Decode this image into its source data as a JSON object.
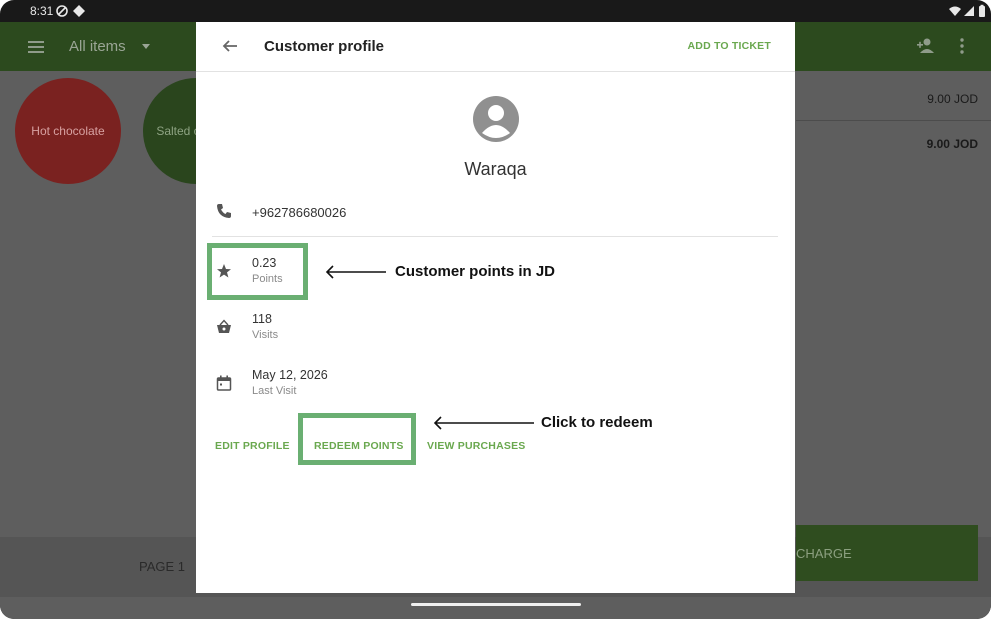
{
  "status_bar": {
    "time": "8:31"
  },
  "background": {
    "toolbar_title": "All items",
    "tiles": [
      {
        "label": "Hot chocolate"
      },
      {
        "label": "Salted c... lat..."
      }
    ],
    "ticket_prices": [
      "9.00 JOD",
      "9.00 JOD"
    ],
    "page_label": "PAGE 1",
    "charge_label": "CHARGE"
  },
  "dialog": {
    "title": "Customer profile",
    "add_to_ticket": "ADD TO TICKET",
    "customer_name": "Waraqa",
    "phone": "+962786680026",
    "points": {
      "value": "0.23",
      "label": "Points"
    },
    "visits": {
      "value": "118",
      "label": "Visits"
    },
    "last_visit": {
      "value": "May 12, 2026",
      "label": "Last Visit"
    },
    "actions": {
      "edit_profile": "EDIT PROFILE",
      "redeem_points": "REDEEM POINTS",
      "view_purchases": "VIEW PURCHASES"
    }
  },
  "annotations": {
    "points_note": "Customer points in JD",
    "redeem_note": "Click to redeem"
  },
  "colors": {
    "accent": "#6aa84f",
    "highlight": "#6aaf72"
  }
}
